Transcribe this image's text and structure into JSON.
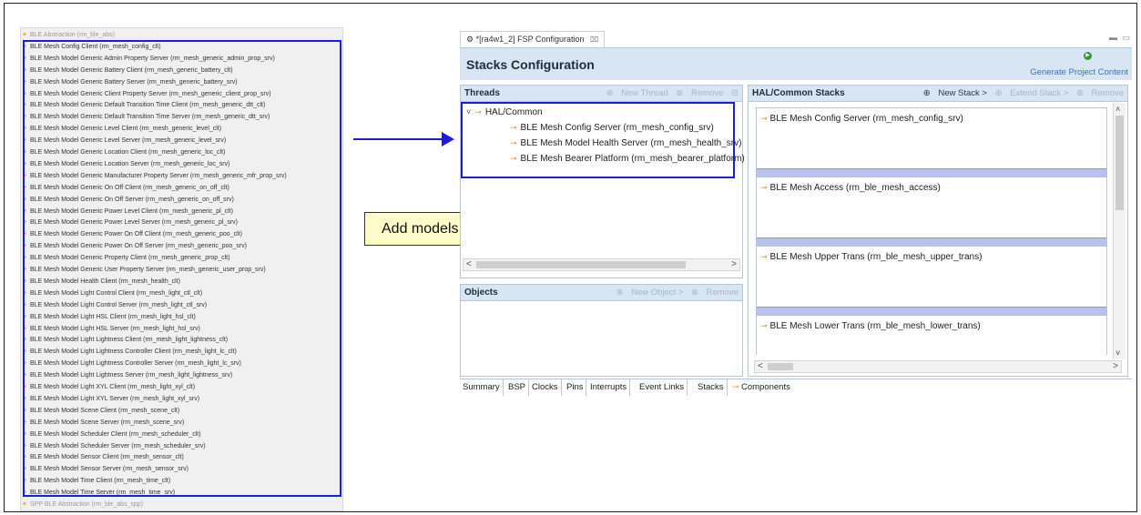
{
  "left_list": {
    "items": [
      "BLE Abstraction (rm_ble_abs)",
      "BLE Mesh Config Client (rm_mesh_config_clt)",
      "BLE Mesh Model Generic Admin Property Server (rm_mesh_generic_admin_prop_srv)",
      "BLE Mesh Model Generic Battery Client (rm_mesh_generic_battery_clt)",
      "BLE Mesh Model Generic Battery Server (rm_mesh_generic_battery_srv)",
      "BLE Mesh Model Generic Client Property Server (rm_mesh_generic_client_prop_srv)",
      "BLE Mesh Model Generic Default Transition Time Client (rm_mesh_generic_dtt_clt)",
      "BLE Mesh Model Generic Default Transition Time Server (rm_mesh_generic_dtt_srv)",
      "BLE Mesh Model Generic Level Client (rm_mesh_generic_level_clt)",
      "BLE Mesh Model Generic Level Server (rm_mesh_generic_level_srv)",
      "BLE Mesh Model Generic Location Client (rm_mesh_generic_loc_clt)",
      "BLE Mesh Model Generic Location Server (rm_mesh_generic_loc_srv)",
      "BLE Mesh Model Generic Manufacturer Property Server (rm_mesh_generic_mfr_prop_srv)",
      "BLE Mesh Model Generic On Off Client (rm_mesh_generic_on_off_clt)",
      "BLE Mesh Model Generic On Off Server (rm_mesh_generic_on_off_srv)",
      "BLE Mesh Model Generic Power Level Client (rm_mesh_generic_pl_clt)",
      "BLE Mesh Model Generic Power Level Server (rm_mesh_generic_pl_srv)",
      "BLE Mesh Model Generic Power On Off Client (rm_mesh_generic_poo_clt)",
      "BLE Mesh Model Generic Power On Off Server (rm_mesh_generic_poo_srv)",
      "BLE Mesh Model Generic Property Client (rm_mesh_generic_prop_clt)",
      "BLE Mesh Model Generic User Property Server (rm_mesh_generic_user_prop_srv)",
      "BLE Mesh Model Health Client (rm_mesh_health_clt)",
      "BLE Mesh Model Light Control Client (rm_mesh_light_ctl_clt)",
      "BLE Mesh Model Light Control Server (rm_mesh_light_ctl_srv)",
      "BLE Mesh Model Light HSL Client (rm_mesh_light_hsl_clt)",
      "BLE Mesh Model Light HSL Server (rm_mesh_light_hsl_srv)",
      "BLE Mesh Model Light Lightness Client (rm_mesh_light_lightness_clt)",
      "BLE Mesh Model Light Lightness Controller Client (rm_mesh_light_lc_clt)",
      "BLE Mesh Model Light Lightness Controller Server (rm_mesh_light_lc_srv)",
      "BLE Mesh Model Light Lightness Server (rm_mesh_light_lightness_srv)",
      "BLE Mesh Model Light XYL Client (rm_mesh_light_xyl_clt)",
      "BLE Mesh Model Light XYL Server (rm_mesh_light_xyl_srv)",
      "BLE Mesh Model Scene Client (rm_mesh_scene_clt)",
      "BLE Mesh Model Scene Server (rm_mesh_scene_srv)",
      "BLE Mesh Model Scheduler Client (rm_mesh_scheduler_clt)",
      "BLE Mesh Model Scheduler Server (rm_mesh_scheduler_srv)",
      "BLE Mesh Model Sensor Client (rm_mesh_sensor_clt)",
      "BLE Mesh Model Sensor Server (rm_mesh_sensor_srv)",
      "BLE Mesh Model Time Client (rm_mesh_time_clt)",
      "BLE Mesh Model Time Server (rm_mesh_time_srv)",
      "SPP BLE Abstraction (rm_ble_abs_spp)"
    ]
  },
  "callout": {
    "text": "Add models you want."
  },
  "fsp": {
    "tab_label": "*[ra4w1_2] FSP Configuration",
    "tab_close": "⌧",
    "header_title": "Stacks Configuration",
    "generate_label": "Generate Project Content",
    "threads": {
      "title": "Threads",
      "new_thread": "New Thread",
      "remove": "Remove",
      "group": "HAL/Common",
      "modules": [
        "BLE Mesh Config Server (rm_mesh_config_srv)",
        "BLE Mesh Model Health Server (rm_mesh_health_srv)",
        "BLE Mesh Bearer Platform (rm_mesh_bearer_platform)"
      ]
    },
    "objects": {
      "title": "Objects",
      "new_object": "New Object >",
      "remove": "Remove"
    },
    "stacks": {
      "title": "HAL/Common Stacks",
      "new_stack": "New Stack >",
      "extend_stack": "Extend Stack >",
      "remove": "Remove",
      "boxes": [
        "BLE Mesh Config Server (rm_mesh_config_srv)",
        "BLE Mesh Access (rm_ble_mesh_access)",
        "BLE Mesh Upper Trans (rm_ble_mesh_upper_trans)",
        "BLE Mesh Lower Trans (rm_ble_mesh_lower_trans)"
      ]
    },
    "bottom_tabs": [
      "Summary",
      "BSP",
      "Clocks",
      "Pins",
      "Interrupts",
      "Event Links",
      "Stacks",
      "Components"
    ]
  },
  "colors": {
    "highlight": "#1d1ddb",
    "header": "#d8e5f3",
    "callout_bg": "#fdfcc9"
  }
}
